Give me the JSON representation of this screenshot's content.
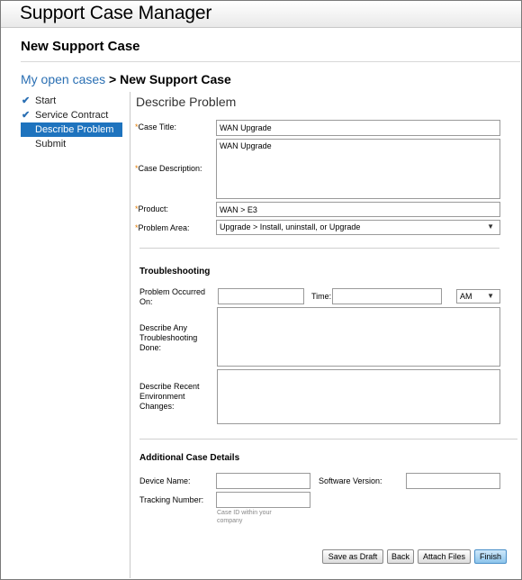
{
  "app": {
    "title": "Support Case Manager"
  },
  "page": {
    "title": "New Support Case"
  },
  "breadcrumb": {
    "link": "My open cases",
    "separator": " > ",
    "current": "New Support Case"
  },
  "steps": [
    {
      "label": "Start",
      "done": true
    },
    {
      "label": "Service Contract",
      "done": true
    },
    {
      "label": "Describe Problem",
      "active": true
    },
    {
      "label": "Submit"
    }
  ],
  "section": {
    "title": "Describe Problem"
  },
  "form": {
    "required_marker": "*",
    "case_title": {
      "label": "Case Title:",
      "value": "WAN Upgrade"
    },
    "case_description": {
      "label": "Case Description:",
      "value": "WAN Upgrade"
    },
    "product": {
      "label": "Product:",
      "value": "WAN > E3"
    },
    "problem_area": {
      "label": "Problem Area:",
      "value": "Upgrade > Install, uninstall, or Upgrade"
    }
  },
  "troubleshooting": {
    "heading": "Troubleshooting",
    "occurred_label": "Problem Occurred On:",
    "occurred_value": "",
    "time_label": "Time:",
    "time_value": "",
    "ampm_value": "AM",
    "done_label": "Describe Any Troubleshooting Done:",
    "done_value": "",
    "changes_label": "Describe Recent Environment Changes:",
    "changes_value": ""
  },
  "details": {
    "heading": "Additional Case Details",
    "device_label": "Device Name:",
    "device_value": "",
    "software_label": "Software Version:",
    "software_value": "",
    "tracking_label": "Tracking Number:",
    "tracking_value": "",
    "tracking_hint": "Case ID within your company"
  },
  "buttons": {
    "save_draft": "Save as Draft",
    "back": "Back",
    "attach": "Attach Files",
    "finish": "Finish"
  },
  "icons": {
    "check": "checkmark-icon",
    "dropdown": "chevron-down-icon"
  },
  "colors": {
    "accent": "#1e73be",
    "link": "#2a6fb3",
    "required": "#e07a00"
  }
}
